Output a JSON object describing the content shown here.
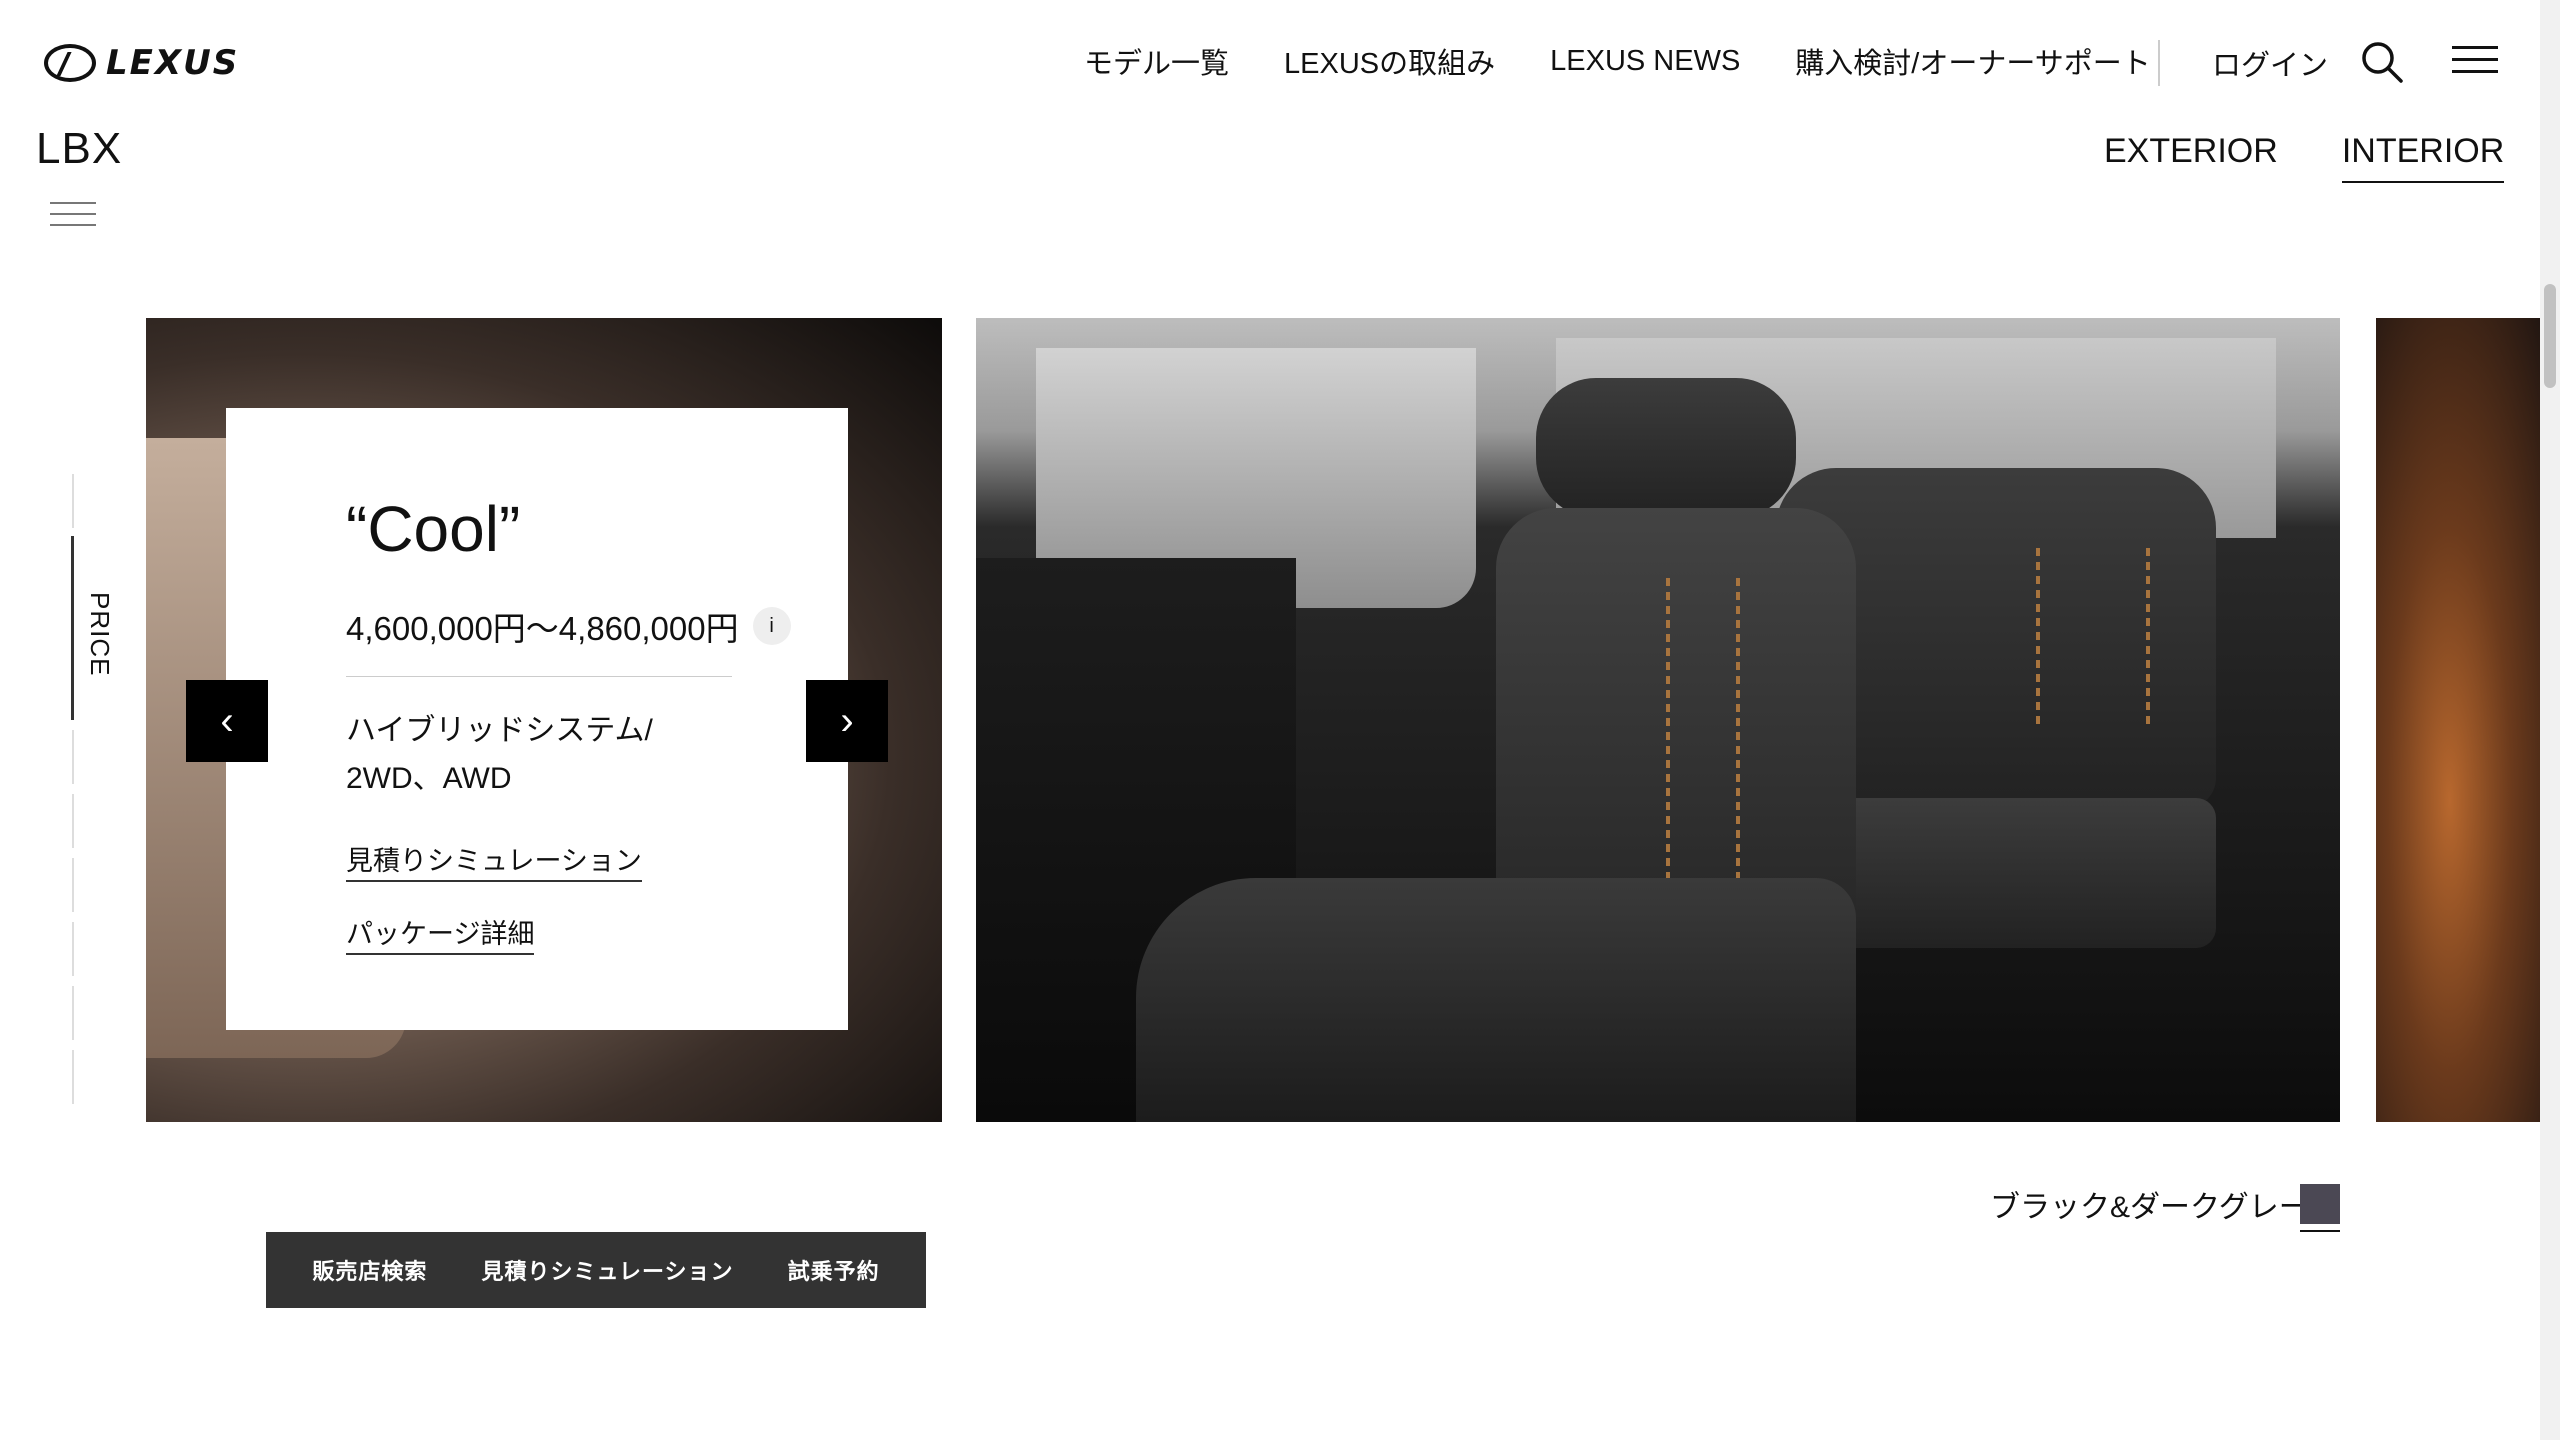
{
  "header": {
    "brand": "LEXUS",
    "nav": [
      "モデル一覧",
      "LEXUSの取組み",
      "LEXUS NEWS",
      "購入検討/オーナーサポート"
    ],
    "login": "ログイン"
  },
  "model": {
    "name": "LBX",
    "tabs": [
      {
        "label": "EXTERIOR",
        "active": false
      },
      {
        "label": "INTERIOR",
        "active": true
      }
    ]
  },
  "side": {
    "label": "PRICE"
  },
  "card": {
    "grade": "“Cool”",
    "price": "4,600,000円～4,860,000円",
    "info_label": "i",
    "system_line1": "ハイブリッドシステム/",
    "system_line2": "2WD、AWD",
    "link_estimate": "見積りシミュレーション",
    "link_package": "パッケージ詳細"
  },
  "carousel": {
    "prev_icon": "‹",
    "next_icon": "›"
  },
  "color": {
    "name": "ブラック&ダークグレー",
    "swatch": "#4b4854"
  },
  "actions": [
    "販売店検索",
    "見積りシミュレーション",
    "試乗予約"
  ]
}
